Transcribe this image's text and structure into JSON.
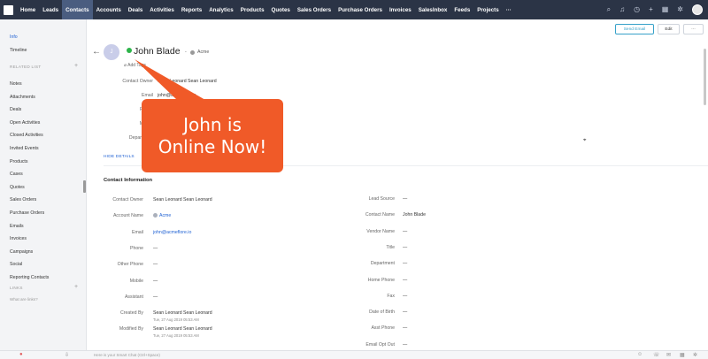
{
  "nav": {
    "items": [
      "Home",
      "Leads",
      "Contacts",
      "Accounts",
      "Deals",
      "Activities",
      "Reports",
      "Analytics",
      "Products",
      "Quotes",
      "Sales Orders",
      "Purchase Orders",
      "Invoices",
      "SalesInbox",
      "Feeds",
      "Projects",
      "···"
    ],
    "active": "Contacts",
    "icons": [
      "search-icon",
      "bell-icon",
      "clock-icon",
      "plus-icon",
      "calendar-icon",
      "gear-icon"
    ]
  },
  "sidebar": {
    "info": "Info",
    "timeline": "Timeline",
    "related_heading": "RELATED LIST",
    "related": [
      "Notes",
      "Attachments",
      "Deals",
      "Open Activities",
      "Closed Activities",
      "Invited Events",
      "Products",
      "Cases",
      "Quotes",
      "Sales Orders",
      "Purchase Orders",
      "Emails",
      "Invoices",
      "Campaigns",
      "Social",
      "Reporting Contacts"
    ],
    "links_heading": "LINKS",
    "whats_this": "What are links?"
  },
  "header": {
    "send_email": "Send Email",
    "edit": "Edit",
    "more": "···",
    "avatar_initial": "J",
    "name": "John Blade",
    "separator": "-",
    "account": "Acme",
    "add_tags": "Add Tags"
  },
  "summary": {
    "fields": [
      {
        "label": "Contact Owner",
        "value": "Sean Leonard Sean Leonard"
      },
      {
        "label": "Email",
        "value": "john@acmeflore.io"
      },
      {
        "label": "Phone",
        "value": ""
      },
      {
        "label": "Mobile",
        "value": ""
      },
      {
        "label": "Department",
        "value": ""
      }
    ],
    "hide_details": "HIDE DETAILS"
  },
  "contact_info": {
    "title": "Contact Information",
    "left": [
      {
        "label": "Contact Owner",
        "value": "Sean Leonard Sean Leonard"
      },
      {
        "label": "Account Name",
        "value": "Acme"
      },
      {
        "label": "Email",
        "value": "john@acmeflore.io"
      },
      {
        "label": "Phone",
        "value": "—"
      },
      {
        "label": "Other Phone",
        "value": "—"
      },
      {
        "label": "Mobile",
        "value": "—"
      },
      {
        "label": "Assistant",
        "value": "—"
      },
      {
        "label": "Created By",
        "value": "Sean Leonard Sean Leonard",
        "sub": "Tue, 27 Aug 2019 05:53 AM"
      },
      {
        "label": "Modified By",
        "value": "Sean Leonard Sean Leonard",
        "sub": "Tue, 27 Aug 2019 05:53 AM"
      }
    ],
    "right": [
      {
        "label": "Lead Source",
        "value": "—"
      },
      {
        "label": "Contact Name",
        "value": "John Blade"
      },
      {
        "label": "Vendor Name",
        "value": "—"
      },
      {
        "label": "Title",
        "value": "—"
      },
      {
        "label": "Department",
        "value": "—"
      },
      {
        "label": "Home Phone",
        "value": "—"
      },
      {
        "label": "Fax",
        "value": "—"
      },
      {
        "label": "Date of Birth",
        "value": "—"
      },
      {
        "label": "Asst Phone",
        "value": "—"
      },
      {
        "label": "Email Opt Out",
        "value": "—"
      }
    ]
  },
  "callout": {
    "line1": "John is",
    "line2": "Online Now!"
  },
  "bottombar": {
    "search_placeholder": "Here is your Smart Chat (Ctrl+Space)"
  },
  "colors": {
    "nav_bg": "#2b3446",
    "accent": "#1f61d3",
    "online": "#2db44a",
    "callout": "#f05a28"
  }
}
